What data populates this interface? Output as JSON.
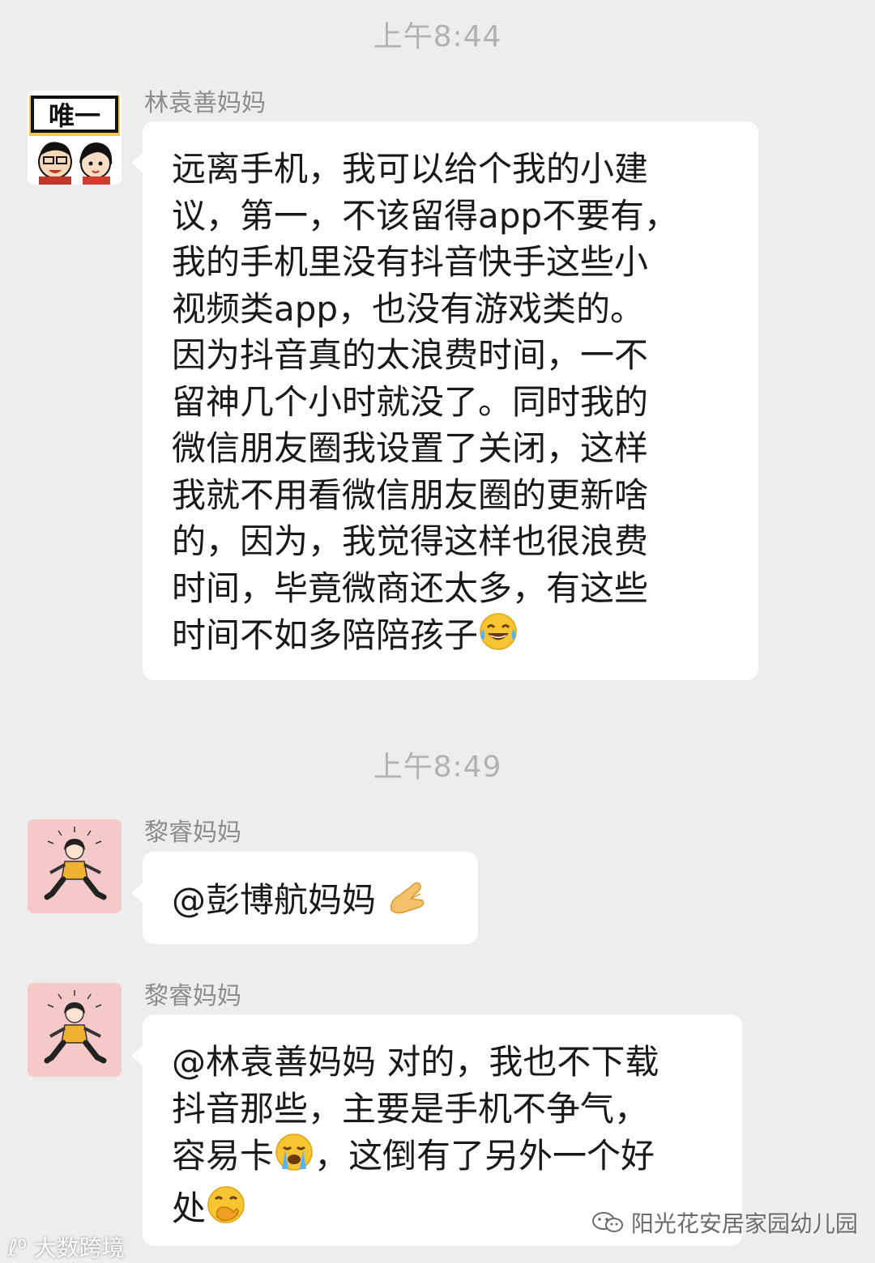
{
  "messages_area": {
    "timestamps": [
      "上午8:44",
      "上午8:49"
    ],
    "msg1": {
      "avatar_badge": "唯一",
      "sender": "林袁善妈妈",
      "lines": [
        "远离手机，我可以给个我的小建",
        "议，第一，不该留得app不要有，",
        "我的手机里没有抖音快手这些小",
        "视频类app，也没有游戏类的。",
        "因为抖音真的太浪费时间，一不",
        "留神几个小时就没了。同时我的",
        "微信朋友圈我设置了关闭，这样",
        "我就不用看微信朋友圈的更新啥",
        "的，因为，我觉得这样也很浪费",
        "时间，毕竟微商还太多，有这些",
        "时间不如多陪陪孩子"
      ],
      "end_emoji": "tears-of-joy-emoji"
    },
    "msg2": {
      "sender": "黎睿妈妈",
      "text": "@彭博航妈妈 ",
      "end_emoji": "pinched-fingers-emoji"
    },
    "msg3": {
      "sender": "黎睿妈妈",
      "line1": "@林袁善妈妈 对的，我也不下载",
      "line2": "抖音那些，主要是手机不争气，",
      "line3a": "容易卡",
      "line3b": "，这倒有了另外一个好",
      "line4": "处",
      "emoji_mid": "loudly-crying-emoji",
      "emoji_end": "hand-over-mouth-emoji"
    }
  },
  "watermarks": {
    "left": "大数跨境",
    "right": "阳光花安居家园幼儿园"
  },
  "colors": {
    "background": "#ededed",
    "bubble": "#ffffff",
    "timestamp": "#b2b2b2",
    "sender": "#8c8c8c"
  }
}
